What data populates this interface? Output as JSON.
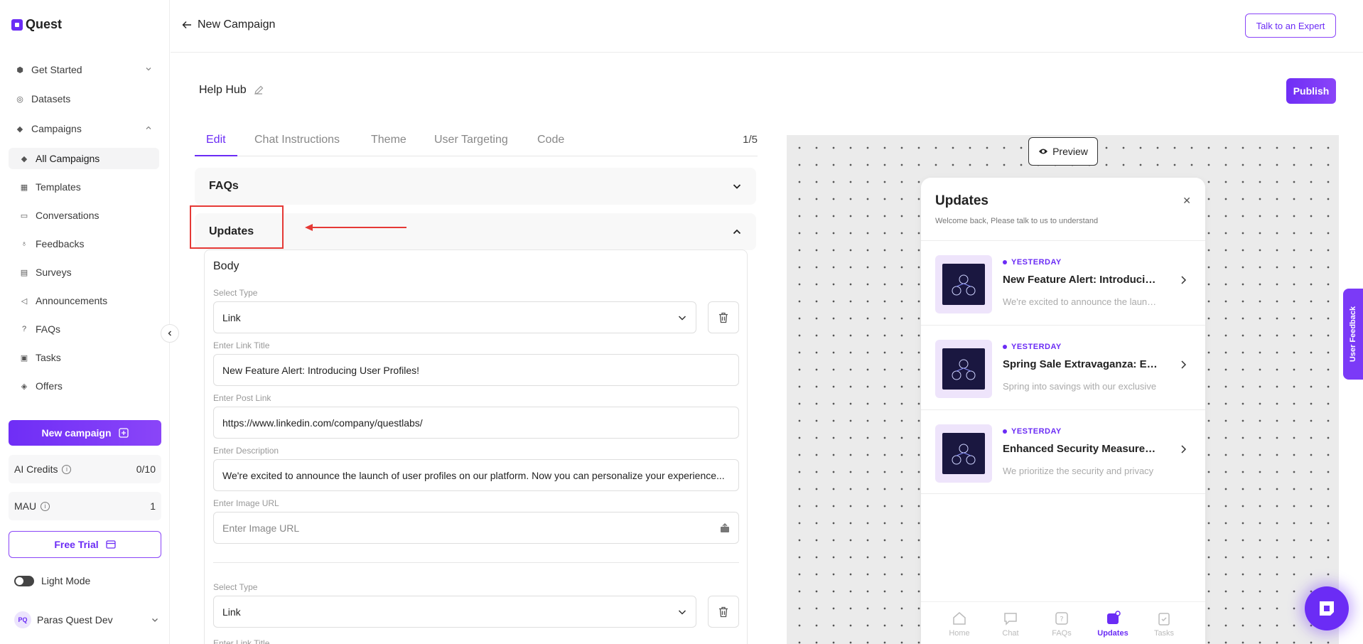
{
  "app": {
    "name": "Quest"
  },
  "sidebar": {
    "items": [
      {
        "label": "Get Started",
        "icon": "cube-icon"
      },
      {
        "label": "Datasets",
        "icon": "database-icon"
      },
      {
        "label": "Campaigns",
        "icon": "layers-icon"
      },
      {
        "label": "All Campaigns",
        "icon": "layers-icon"
      },
      {
        "label": "Templates",
        "icon": "grid-icon"
      },
      {
        "label": "Conversations",
        "icon": "chat-icon"
      },
      {
        "label": "Feedbacks",
        "icon": "feedback-icon"
      },
      {
        "label": "Surveys",
        "icon": "chart-icon"
      },
      {
        "label": "Announcements",
        "icon": "megaphone-icon"
      },
      {
        "label": "FAQs",
        "icon": "question-icon"
      },
      {
        "label": "Tasks",
        "icon": "task-icon"
      },
      {
        "label": "Offers",
        "icon": "tag-icon"
      }
    ],
    "new_campaign": "New campaign",
    "ai_credits": {
      "label": "AI Credits",
      "value": "0/10"
    },
    "mau": {
      "label": "MAU",
      "value": "1"
    },
    "free_trial": "Free Trial",
    "light_mode": "Light Mode",
    "user": {
      "initials": "PQ",
      "name": "Paras Quest Dev"
    }
  },
  "header": {
    "title": "New Campaign",
    "expert_button": "Talk to an Expert"
  },
  "campaign": {
    "name": "Help Hub",
    "publish": "Publish",
    "tabs": [
      "Edit",
      "Chat Instructions",
      "Theme",
      "User Targeting",
      "Code"
    ],
    "step": "1/5"
  },
  "sections": {
    "faqs": "FAQs",
    "updates": "Updates"
  },
  "body": {
    "title": "Body",
    "labels": {
      "select_type": "Select Type",
      "link_title": "Enter Link Title",
      "post_link": "Enter Post Link",
      "description": "Enter Description",
      "image_url": "Enter Image URL"
    },
    "item1": {
      "type": "Link",
      "link_title": "New Feature Alert: Introducing User Profiles!",
      "post_link": "https://www.linkedin.com/company/questlabs/",
      "description": "We're excited to announce the launch of user profiles on our platform. Now you can personalize your experience...",
      "image_placeholder": "Enter Image URL"
    },
    "item2": {
      "type": "Link"
    }
  },
  "preview": {
    "button": "Preview",
    "widget": {
      "title": "Updates",
      "subtitle": "Welcome back, Please talk to us to understand",
      "items": [
        {
          "meta": "YESTERDAY",
          "title": "New Feature Alert: Introducing User Profiles!",
          "desc": "We're excited to announce the launch of user profiles"
        },
        {
          "meta": "YESTERDAY",
          "title": "Spring Sale Extravaganza: Enjoy",
          "desc": "Spring into savings with our exclusive"
        },
        {
          "meta": "YESTERDAY",
          "title": "Enhanced Security Measures: Your Safety",
          "desc": "We prioritize the security and privacy"
        }
      ],
      "nav": [
        "Home",
        "Chat",
        "FAQs",
        "Updates",
        "Tasks"
      ]
    },
    "feedback_tab": "User Feedback"
  },
  "colors": {
    "accent": "#6b2cf5",
    "highlight": "#e53935"
  }
}
